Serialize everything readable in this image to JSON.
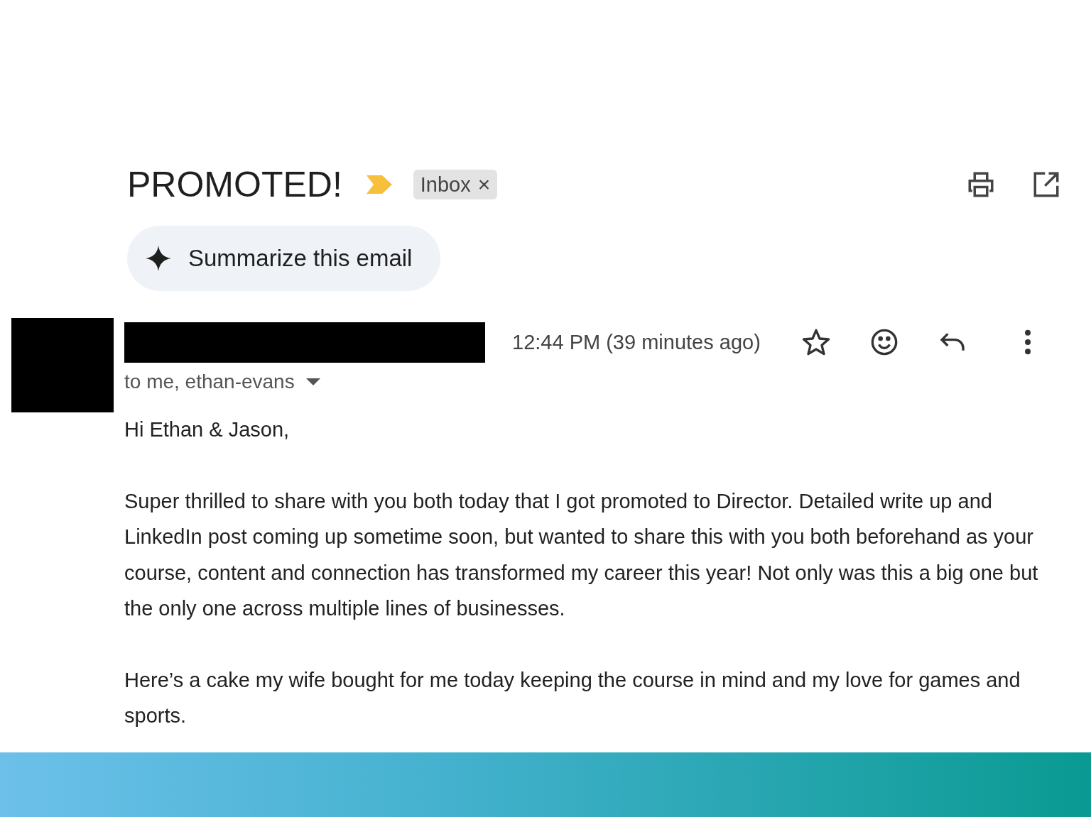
{
  "subject": "PROMOTED!",
  "labels": [
    {
      "text": "Inbox",
      "remove_glyph": "×"
    }
  ],
  "summarize_button": "Summarize this email",
  "message": {
    "timestamp": "12:44 PM (39 minutes ago)",
    "starred": false,
    "recipients": "to me, ethan-evans",
    "body": [
      "Hi Ethan & Jason,",
      "Super thrilled to share with you both today that I got promoted to Director. Detailed write up and LinkedIn post coming up sometime soon, but wanted to share this with you both beforehand as your course, content and connection has transformed my career this year! Not only was this a big one but the only one across multiple lines of businesses.",
      "Here’s a cake my wife bought for me today keeping the course in mind and my love for games and sports."
    ]
  }
}
